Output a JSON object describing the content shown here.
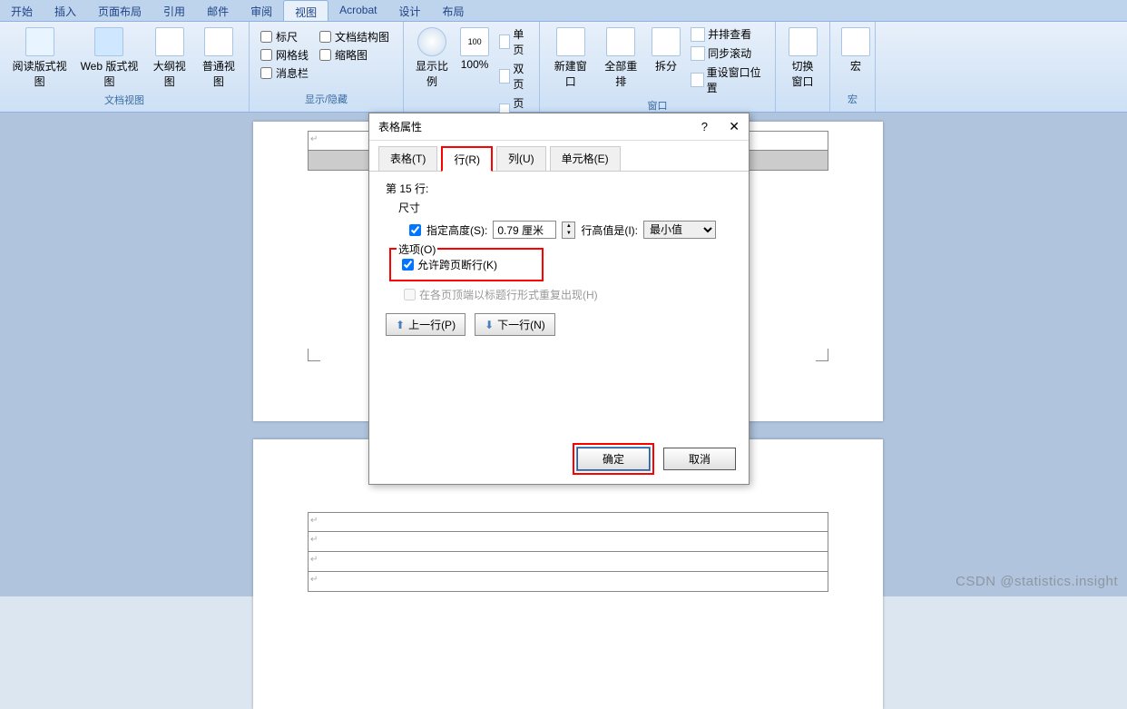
{
  "tabs": [
    "开始",
    "插入",
    "页面布局",
    "引用",
    "邮件",
    "审阅",
    "视图",
    "Acrobat",
    "设计",
    "布局"
  ],
  "active_tab_index": 6,
  "ribbon": {
    "g1": {
      "label": "文档视图",
      "btns": [
        "阅读版式视图",
        "Web 版式视图",
        "大纲视图",
        "普通视图"
      ]
    },
    "g2": {
      "label": "显示/隐藏",
      "checks": [
        "标尺",
        "网格线",
        "消息栏",
        "文档结构图",
        "缩略图"
      ]
    },
    "g3": {
      "label": "显示比例",
      "zoom_btn": "显示比例",
      "pct": "100%",
      "z1": "单页",
      "z2": "双页",
      "z3": "页宽"
    },
    "g4": {
      "label": "窗口",
      "b1": "新建窗口",
      "b2": "全部重排",
      "b3": "拆分",
      "s1": "并排查看",
      "s2": "同步滚动",
      "s3": "重设窗口位置"
    },
    "g5": {
      "label": "",
      "btn": "切换窗口"
    },
    "g6": {
      "label": "宏",
      "btn": "宏"
    }
  },
  "dialog": {
    "title": "表格属性",
    "tabs": {
      "table": "表格(T)",
      "row": "行(R)",
      "col": "列(U)",
      "cell": "单元格(E)"
    },
    "body": {
      "row_num": "第 15 行:",
      "size_label": "尺寸",
      "height_check": "指定高度(S):",
      "height_val": "0.79 厘米",
      "height_type_label": "行高值是(I):",
      "height_type_val": "最小值",
      "options_legend": "选项(O)",
      "allow_break": "允许跨页断行(K)",
      "repeat_header": "在各页顶端以标题行形式重复出现(H)",
      "prev": "上一行(P)",
      "next": "下一行(N)"
    },
    "ok": "确定",
    "cancel": "取消"
  },
  "watermark": "CSDN @statistics.insight"
}
